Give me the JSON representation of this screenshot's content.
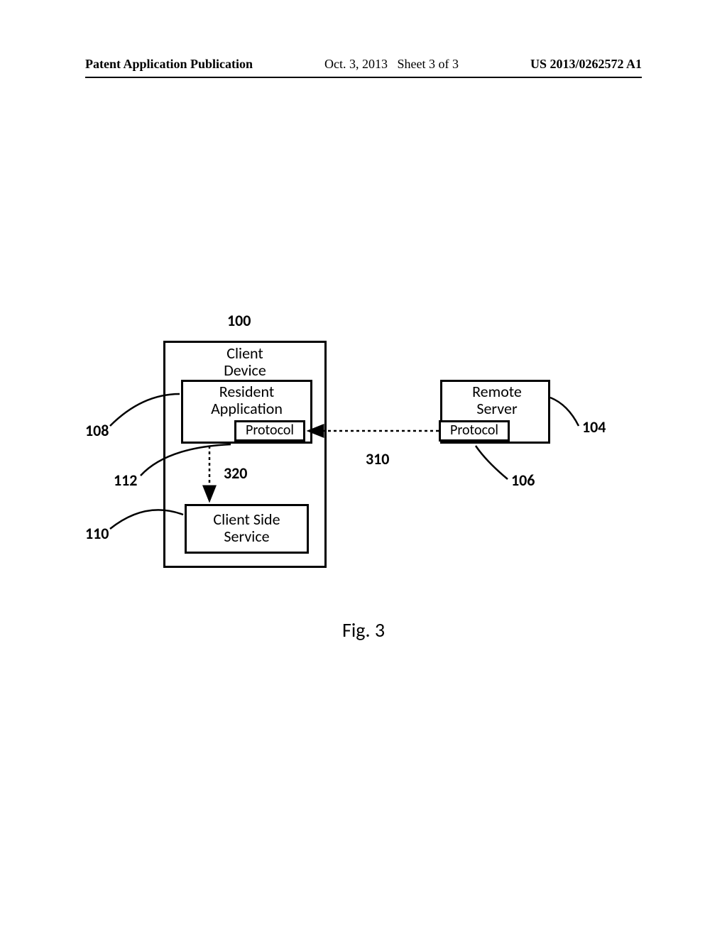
{
  "header": {
    "publication": "Patent Application Publication",
    "middle": "Oct. 3, 2013   Sheet 3 of 3",
    "number": "US 2013/0262572 A1"
  },
  "figure": {
    "caption": "Fig. 3",
    "ref_100": "100",
    "client_device": "Client\nDevice",
    "resident_application": "Resident\nApplication",
    "protocol_left": "Protocol",
    "protocol_right": "Protocol",
    "client_side_service": "Client Side\nService",
    "remote_server": "Remote\nServer",
    "ref_108": "108",
    "ref_112": "112",
    "ref_110": "110",
    "ref_104": "104",
    "ref_106": "106",
    "ref_310": "310",
    "ref_320": "320"
  }
}
